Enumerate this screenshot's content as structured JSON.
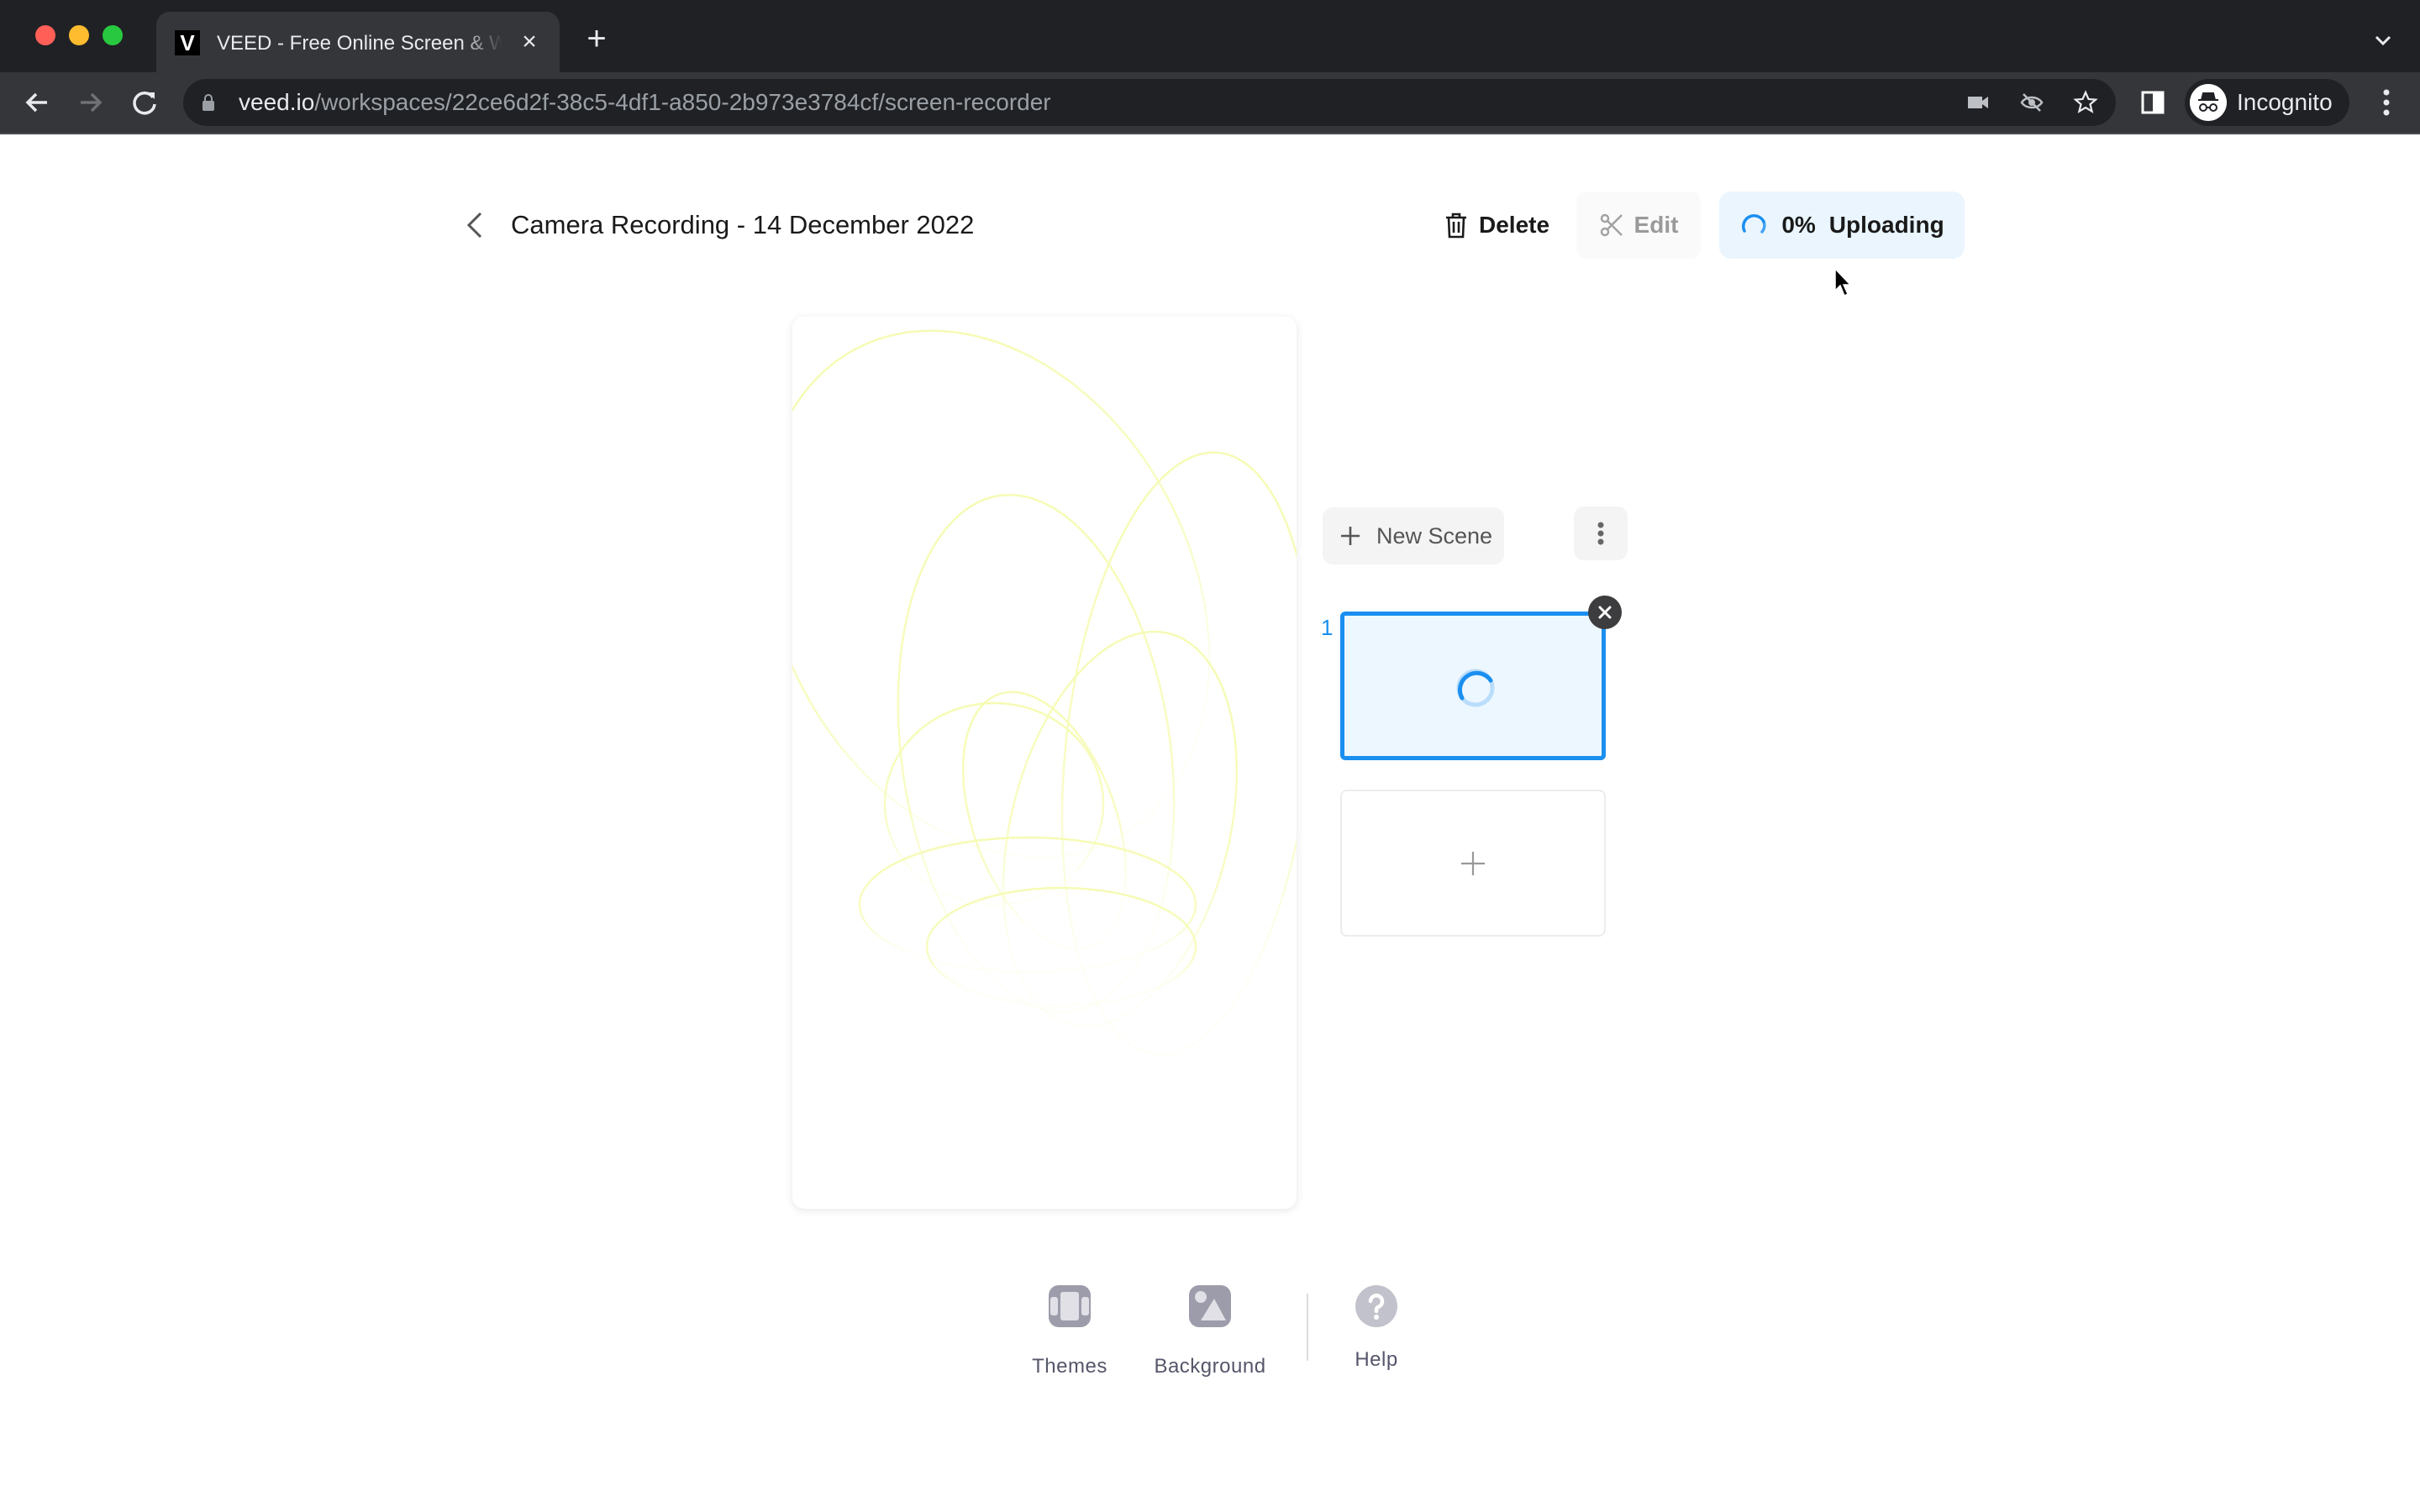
{
  "browser": {
    "tab": {
      "favicon_letter": "V",
      "title": "VEED - Free Online Screen & Webcam Recorder",
      "close_label": "×"
    },
    "new_tab_label": "+",
    "url_host": "veed.io",
    "url_path": "/workspaces/22ce6d2f-38c5-4df1-a850-2b973e3784cf/screen-recorder",
    "profile_label": "Incognito",
    "colors": {
      "traffic_close": "#ff5f57",
      "traffic_minimize": "#febc2e",
      "traffic_maximize": "#28c840"
    }
  },
  "header": {
    "title": "Camera Recording - 14 December 2022",
    "delete_label": "Delete",
    "edit_label": "Edit",
    "upload_percent": "0%",
    "upload_status": "Uploading"
  },
  "scenes": {
    "new_scene_label": "New Scene",
    "items": [
      {
        "number": "1",
        "state": "loading",
        "selected": true
      }
    ],
    "accent_color": "#1a8ff0"
  },
  "bottom_toolbar": {
    "items": [
      {
        "label": "Themes",
        "icon": "themes-icon"
      },
      {
        "label": "Background",
        "icon": "background-image-icon"
      },
      {
        "label": "Help",
        "icon": "help-icon"
      }
    ]
  }
}
